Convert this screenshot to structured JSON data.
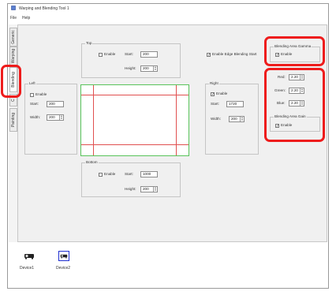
{
  "window": {
    "title": "Warping and Blending Tool 1"
  },
  "menu": [
    "File",
    "Help"
  ],
  "tabs": [
    {
      "label": "Generic",
      "active": false
    },
    {
      "label": "Warping",
      "active": false
    },
    {
      "label": "Blending",
      "active": true
    },
    {
      "label": "C",
      "active": false
    },
    {
      "label": "Painting",
      "active": false
    }
  ],
  "top": {
    "title": "Top",
    "enable_label": "Enable",
    "start_label": "Start:",
    "start_value": "200",
    "height_label": "Height:",
    "height_value": "200"
  },
  "left": {
    "title": "Left",
    "enable_label": "Enable",
    "start_label": "Start:",
    "start_value": "200",
    "width_label": "Width:",
    "width_value": "200"
  },
  "right": {
    "title": "Right",
    "enable_label": "Enable",
    "enable_checked": true,
    "start_label": "Start:",
    "start_value": "1720",
    "width_label": "Width:",
    "width_value": "200"
  },
  "bottom": {
    "title": "Bottom",
    "enable_label": "Enable",
    "start_label": "Start:",
    "start_value": "1000",
    "height_label": "Height:",
    "height_value": "200"
  },
  "edge_blending": {
    "label": "Enable Edge Blending Start",
    "checked": true
  },
  "gamma": {
    "title": "Blending Area Gamma",
    "enable_label": "Enable",
    "checked": true
  },
  "rgb": {
    "red_label": "Red:",
    "red_value": "2.20",
    "green_label": "Green:",
    "green_value": "2.20",
    "blue_label": "Blue:",
    "blue_value": "2.20"
  },
  "gain": {
    "title": "Blending Area Gain",
    "enable_label": "Enable",
    "checked": true
  },
  "devices": [
    {
      "label": "Device1",
      "selected": false
    },
    {
      "label": "Device2",
      "selected": true
    }
  ],
  "colors": {
    "highlight": "#ee1c1c",
    "preview_border": "#58c35a",
    "preview_lines": "#e05050",
    "device_selected": "#2030d0"
  }
}
